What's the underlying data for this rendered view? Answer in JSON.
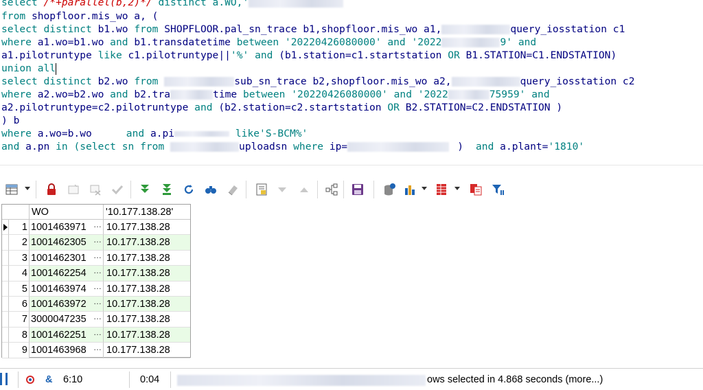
{
  "sql": {
    "l1": {
      "a": "select ",
      "b": "/*+parallel(b,2)*/",
      "c": " distinct a.WO,'"
    },
    "l2": {
      "a": "from ",
      "b": "shopfloor.mis_wo a, ("
    },
    "l3": {
      "a": "select distinct ",
      "b": "b1.wo ",
      "c": "from ",
      "d": "SHOPFLOOR.pal_sn_trace b1,shopfloor.mis_wo a1,",
      "e": "query_iosstation c1"
    },
    "l4": {
      "a": "where ",
      "b": "a1.wo=b1.wo ",
      "c": "and ",
      "d": "b1.transdatetime ",
      "e": "between ",
      "f": "'20220426080000' ",
      "g": "and ",
      "h": "'2022",
      "i": "9' ",
      "j": "and"
    },
    "l5": {
      "a": "a1.pilotruntype ",
      "b": "like ",
      "c": "c1.pilotruntype||",
      "d": "'%' ",
      "e": "and ",
      "f": "(b1.station=c1.startstation ",
      "g": "OR ",
      "h": "B1.STATION=C1.ENDSTATION)"
    },
    "l6": {
      "a": "union all"
    },
    "l7": {
      "a": "select distinct ",
      "b": "b2.wo ",
      "c": "from ",
      "d": "sub_sn_trace b2,shopfloor.mis_wo a2,",
      "e": "query_iosstation c2"
    },
    "l8": {
      "a": "where ",
      "b": "a2.wo=b2.wo ",
      "c": "and ",
      "d": "b2.tra",
      "e": "time ",
      "f": "between ",
      "g": "'20220426080000' ",
      "h": "and ",
      "i": "'2022",
      "j": "75959' ",
      "k": "and"
    },
    "l9": {
      "a": "a2.pilotruntype=c2.pilotruntype ",
      "b": "and ",
      "c": "(b2.station=c2.startstation ",
      "d": "OR ",
      "e": "B2.STATION=C2.ENDSTATION )"
    },
    "l10": {
      "a": ") b"
    },
    "l11": {
      "a": "where ",
      "b": "a.wo=b.wo",
      "c": "and ",
      "d": "a.pi",
      "e": " like",
      "f": "'S-BCM%'"
    },
    "l12": {
      "a": "and ",
      "b": "a.pn ",
      "c": "in ",
      "d": "(select sn ",
      "e": "from ",
      "f": "uploadsn ",
      "g": "where ",
      "h": "ip=",
      "i": ")",
      "j": "and ",
      "k": "a.plant=",
      "l": "'1810'"
    }
  },
  "toolbar": {
    "icons": [
      "grid-menu-icon",
      "lock-icon",
      "insert-record-icon",
      "delete-record-icon",
      "post-edit-icon",
      "fetch-next-icon",
      "fetch-last-icon",
      "refresh-icon",
      "find-icon",
      "clear-icon",
      "record-view-icon",
      "sort-down-icon",
      "sort-up-icon",
      "link-tree-icon",
      "save-icon",
      "export-icon",
      "chart-icon",
      "grid-options-icon",
      "compare-icon",
      "filter-icon"
    ]
  },
  "grid": {
    "columns": [
      "WO",
      "'10.177.138.28'"
    ],
    "rows": [
      {
        "n": "1",
        "wo": "1001463971",
        "ip": "10.177.138.28"
      },
      {
        "n": "2",
        "wo": "1001462305",
        "ip": "10.177.138.28"
      },
      {
        "n": "3",
        "wo": "1001462301",
        "ip": "10.177.138.28"
      },
      {
        "n": "4",
        "wo": "1001462254",
        "ip": "10.177.138.28"
      },
      {
        "n": "5",
        "wo": "1001463974",
        "ip": "10.177.138.28"
      },
      {
        "n": "6",
        "wo": "1001463972",
        "ip": "10.177.138.28"
      },
      {
        "n": "7",
        "wo": "3000047235",
        "ip": "10.177.138.28"
      },
      {
        "n": "8",
        "wo": "1001462251",
        "ip": "10.177.138.28"
      },
      {
        "n": "9",
        "wo": "1001463968",
        "ip": "10.177.138.28"
      }
    ],
    "ellipsis": "…"
  },
  "status": {
    "cursor": "6:10",
    "elapsed": "0:04",
    "message": "ows selected in 4.868 seconds (more...)"
  },
  "colors": {
    "keyword": "#008080",
    "identifier": "#000080",
    "comment": "#cc0000",
    "alt_row": "#e9fbe6"
  }
}
